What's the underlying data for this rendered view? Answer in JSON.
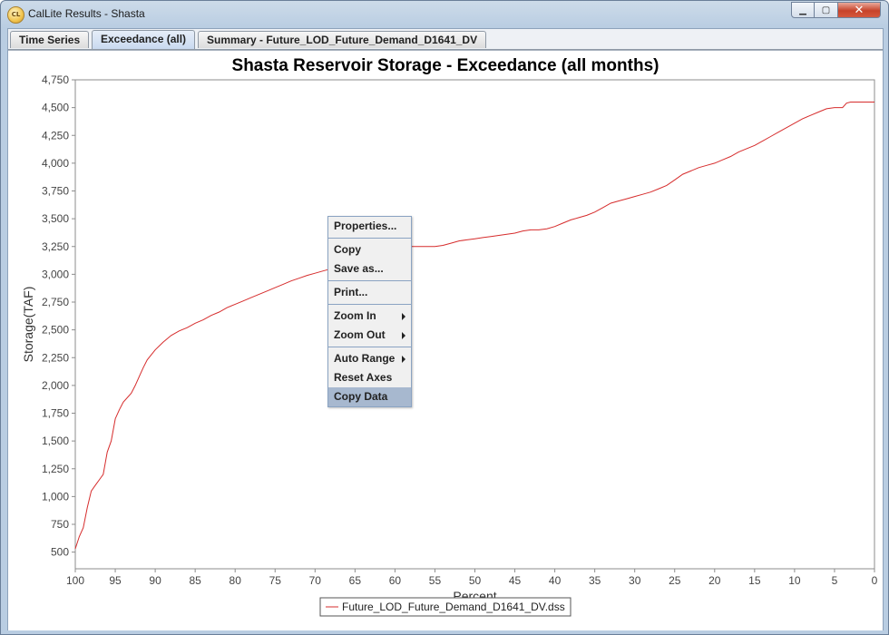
{
  "window": {
    "title": "CalLite Results - Shasta",
    "icon_text": "CL",
    "controls": {
      "minimize": "▁",
      "maximize": "▢",
      "close": "✕"
    }
  },
  "tabs": [
    {
      "label": "Time Series",
      "active": false
    },
    {
      "label": "Exceedance (all)",
      "active": true
    },
    {
      "label": "Summary - Future_LOD_Future_Demand_D1641_DV",
      "active": false
    }
  ],
  "context_menu": {
    "items": [
      {
        "label": "Properties...",
        "group": 1
      },
      {
        "label": "Copy",
        "group": 2
      },
      {
        "label": "Save as...",
        "group": 2
      },
      {
        "label": "Print...",
        "group": 3
      },
      {
        "label": "Zoom In",
        "group": 4,
        "submenu": true
      },
      {
        "label": "Zoom Out",
        "group": 4,
        "submenu": true
      },
      {
        "label": "Auto Range",
        "group": 5,
        "submenu": true
      },
      {
        "label": "Reset Axes",
        "group": 5
      },
      {
        "label": "Copy Data",
        "group": 5,
        "highlighted": true
      }
    ]
  },
  "chart_data": {
    "type": "line",
    "title": "Shasta Reservoir Storage - Exceedance (all months)",
    "xlabel": "Percent",
    "ylabel": "Storage(TAF)",
    "xlim": [
      100,
      0
    ],
    "ylim": [
      350,
      4750
    ],
    "x_ticks": [
      "100",
      "95",
      "90",
      "85",
      "80",
      "75",
      "70",
      "65",
      "60",
      "55",
      "50",
      "45",
      "40",
      "35",
      "30",
      "25",
      "20",
      "15",
      "10",
      "5",
      "0"
    ],
    "y_ticks": [
      "500",
      "750",
      "1,000",
      "1,250",
      "1,500",
      "1,750",
      "2,000",
      "2,250",
      "2,500",
      "2,750",
      "3,000",
      "3,250",
      "3,500",
      "3,750",
      "4,000",
      "4,250",
      "4,500",
      "4,750"
    ],
    "grid": false,
    "legend_position": "bottom",
    "series": [
      {
        "name": "Future_LOD_Future_Demand_D1641_DV.dss",
        "color": "#d62c2c",
        "x": [
          100,
          99.5,
          99,
          98.5,
          98,
          97.5,
          97,
          96.5,
          96,
          95.5,
          95,
          94.5,
          94,
          93,
          92.5,
          92,
          91.5,
          91,
          90,
          89,
          88,
          87,
          86,
          85,
          84,
          83,
          82,
          81,
          80,
          79,
          78,
          77,
          76,
          75,
          74,
          73,
          72,
          71,
          70,
          69,
          68,
          67,
          66,
          65,
          64,
          63,
          62,
          61,
          60,
          59,
          58,
          57,
          56,
          55,
          54,
          53,
          52,
          51,
          50,
          49,
          48,
          47,
          46,
          45,
          44,
          43,
          42,
          41,
          40,
          39,
          38,
          37,
          36,
          35,
          34,
          33,
          32,
          31,
          30,
          29,
          28,
          27,
          26,
          25,
          24,
          23,
          22,
          21,
          20,
          19,
          18,
          17,
          16,
          15,
          14,
          13,
          12,
          11,
          10,
          9,
          8,
          7,
          6,
          5,
          4,
          3.5,
          3,
          2,
          1,
          0
        ],
        "y": [
          530,
          640,
          720,
          900,
          1050,
          1100,
          1150,
          1200,
          1400,
          1500,
          1700,
          1780,
          1850,
          1930,
          2000,
          2080,
          2160,
          2230,
          2320,
          2390,
          2450,
          2490,
          2520,
          2560,
          2590,
          2630,
          2660,
          2700,
          2730,
          2760,
          2790,
          2820,
          2850,
          2880,
          2910,
          2940,
          2965,
          2990,
          3010,
          3030,
          3050,
          3080,
          3130,
          3180,
          3230,
          3250,
          3250,
          3250,
          3250,
          3250,
          3250,
          3250,
          3250,
          3250,
          3260,
          3280,
          3300,
          3310,
          3320,
          3330,
          3340,
          3350,
          3360,
          3370,
          3390,
          3400,
          3400,
          3410,
          3430,
          3460,
          3490,
          3510,
          3530,
          3560,
          3600,
          3640,
          3660,
          3680,
          3700,
          3720,
          3740,
          3770,
          3800,
          3850,
          3900,
          3930,
          3960,
          3980,
          4000,
          4030,
          4060,
          4100,
          4130,
          4160,
          4200,
          4240,
          4280,
          4320,
          4360,
          4400,
          4430,
          4460,
          4490,
          4500,
          4500,
          4540,
          4550,
          4550,
          4550,
          4550
        ]
      }
    ]
  }
}
